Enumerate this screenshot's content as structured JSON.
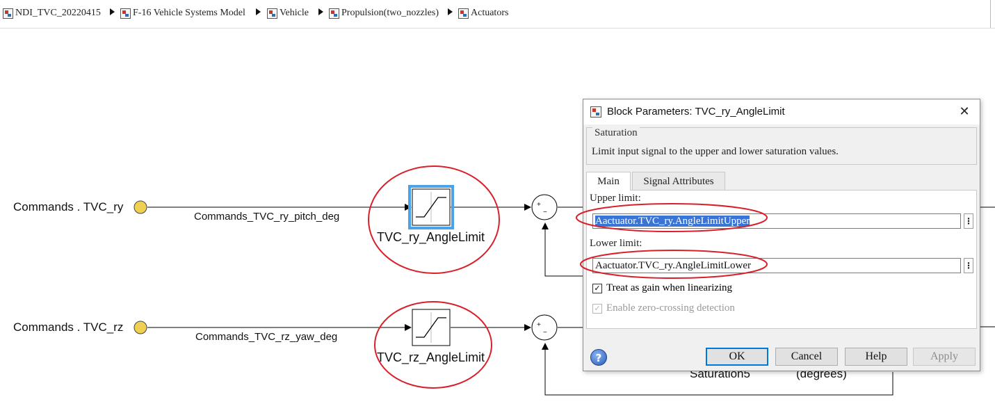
{
  "breadcrumb": {
    "items": [
      {
        "label": "NDI_TVC_20220415"
      },
      {
        "label": "F-16 Vehicle Systems Model"
      },
      {
        "label": "Vehicle"
      },
      {
        "label": "Propulsion(two_nozzles)"
      },
      {
        "label": "Actuators"
      }
    ]
  },
  "diagram": {
    "inport_ry": "Commands . TVC_ry",
    "inport_rz": "Commands . TVC_rz",
    "signal_ry": "Commands_TVC_ry_pitch_deg",
    "signal_rz": "Commands_TVC_rz_yaw_deg",
    "block_ry": "TVC_ry_AngleLimit",
    "block_rz": "TVC_rz_AngleLimit",
    "sum_plus": "+",
    "sum_minus": "−",
    "partial_label_1": "Saturation5",
    "partial_label_2": "(degrees)",
    "highlight_color": "#d9202a",
    "inport_color": "#f0d050",
    "selection_color": "#4aa3e8"
  },
  "dialog": {
    "title": "Block Parameters: TVC_ry_AngleLimit",
    "close_glyph": "✕",
    "group_title": "Saturation",
    "description": "Limit input signal to the upper and lower saturation values.",
    "tabs": [
      {
        "label": "Main",
        "active": true
      },
      {
        "label": "Signal Attributes",
        "active": false
      }
    ],
    "upper_limit_label": "Upper limit:",
    "upper_limit_value": "Aactuator.TVC_ry.AngleLimitUpper",
    "lower_limit_label": "Lower limit:",
    "lower_limit_value": "Aactuator.TVC_ry.AngleLimitLower",
    "more_glyph": "⋮",
    "treat_as_gain": {
      "label": "Treat as gain when linearizing",
      "checked": true
    },
    "zero_crossing": {
      "label": "Enable zero-crossing detection",
      "checked": true,
      "disabled": true
    },
    "help_glyph": "?",
    "buttons": {
      "ok": "OK",
      "cancel": "Cancel",
      "help": "Help",
      "apply": "Apply"
    }
  }
}
